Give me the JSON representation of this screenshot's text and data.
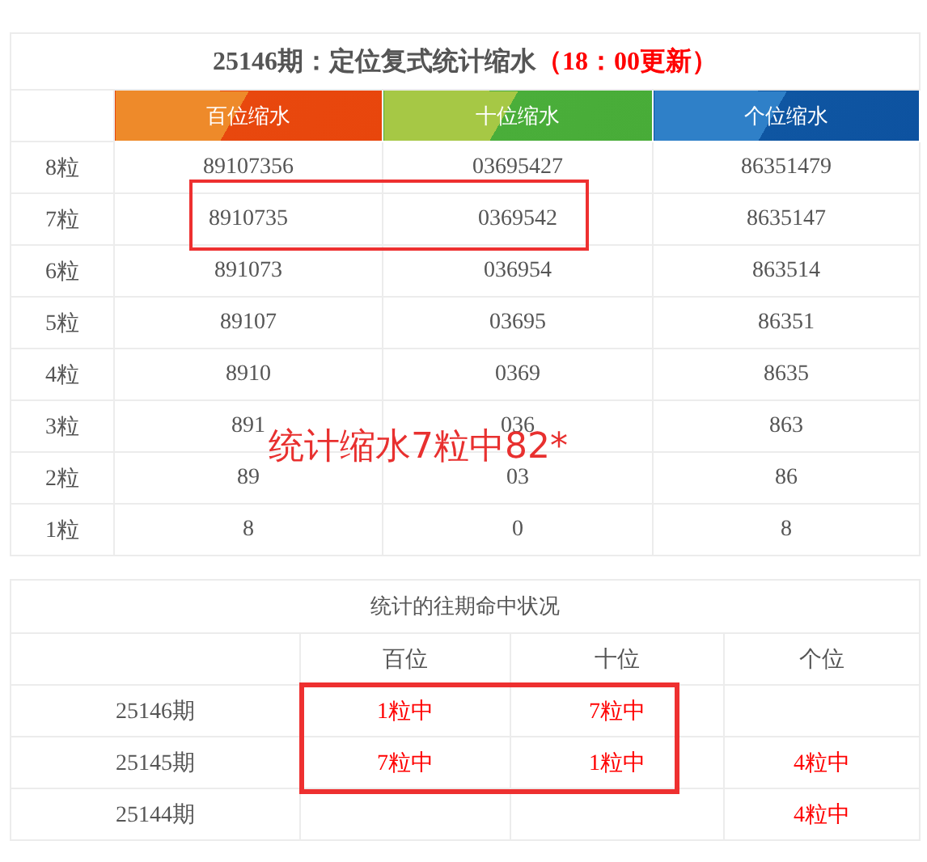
{
  "shrink_table": {
    "title": "25146期：定位复式统计缩水",
    "update_note": "（18：00更新）",
    "columns": [
      {
        "label": "百位缩水",
        "kind": "orange"
      },
      {
        "label": "十位缩水",
        "kind": "green"
      },
      {
        "label": "个位缩水",
        "kind": "blue"
      }
    ],
    "rows": [
      {
        "label": "8粒",
        "values": [
          "89107356",
          "03695427",
          "86351479"
        ]
      },
      {
        "label": "7粒",
        "values": [
          "8910735",
          "0369542",
          "8635147"
        ]
      },
      {
        "label": "6粒",
        "values": [
          "891073",
          "036954",
          "863514"
        ]
      },
      {
        "label": "5粒",
        "values": [
          "89107",
          "03695",
          "86351"
        ]
      },
      {
        "label": "4粒",
        "values": [
          "8910",
          "0369",
          "8635"
        ]
      },
      {
        "label": "3粒",
        "values": [
          "891",
          "036",
          "863"
        ]
      },
      {
        "label": "2粒",
        "values": [
          "89",
          "03",
          "86"
        ]
      },
      {
        "label": "1粒",
        "values": [
          "8",
          "0",
          "8"
        ]
      }
    ]
  },
  "annotation": "统计缩水7粒中82*",
  "hit_table": {
    "title": "统计的往期命中状况",
    "columns": [
      "百位",
      "十位",
      "个位"
    ],
    "rows": [
      {
        "period": "25146期",
        "hundreds": "1粒中",
        "tens": "7粒中"
      },
      {
        "period": "25145期",
        "hundreds": "7粒中",
        "tens": "1粒中",
        "units": "4粒中"
      },
      {
        "period": "25144期",
        "units": "4粒中"
      }
    ]
  }
}
